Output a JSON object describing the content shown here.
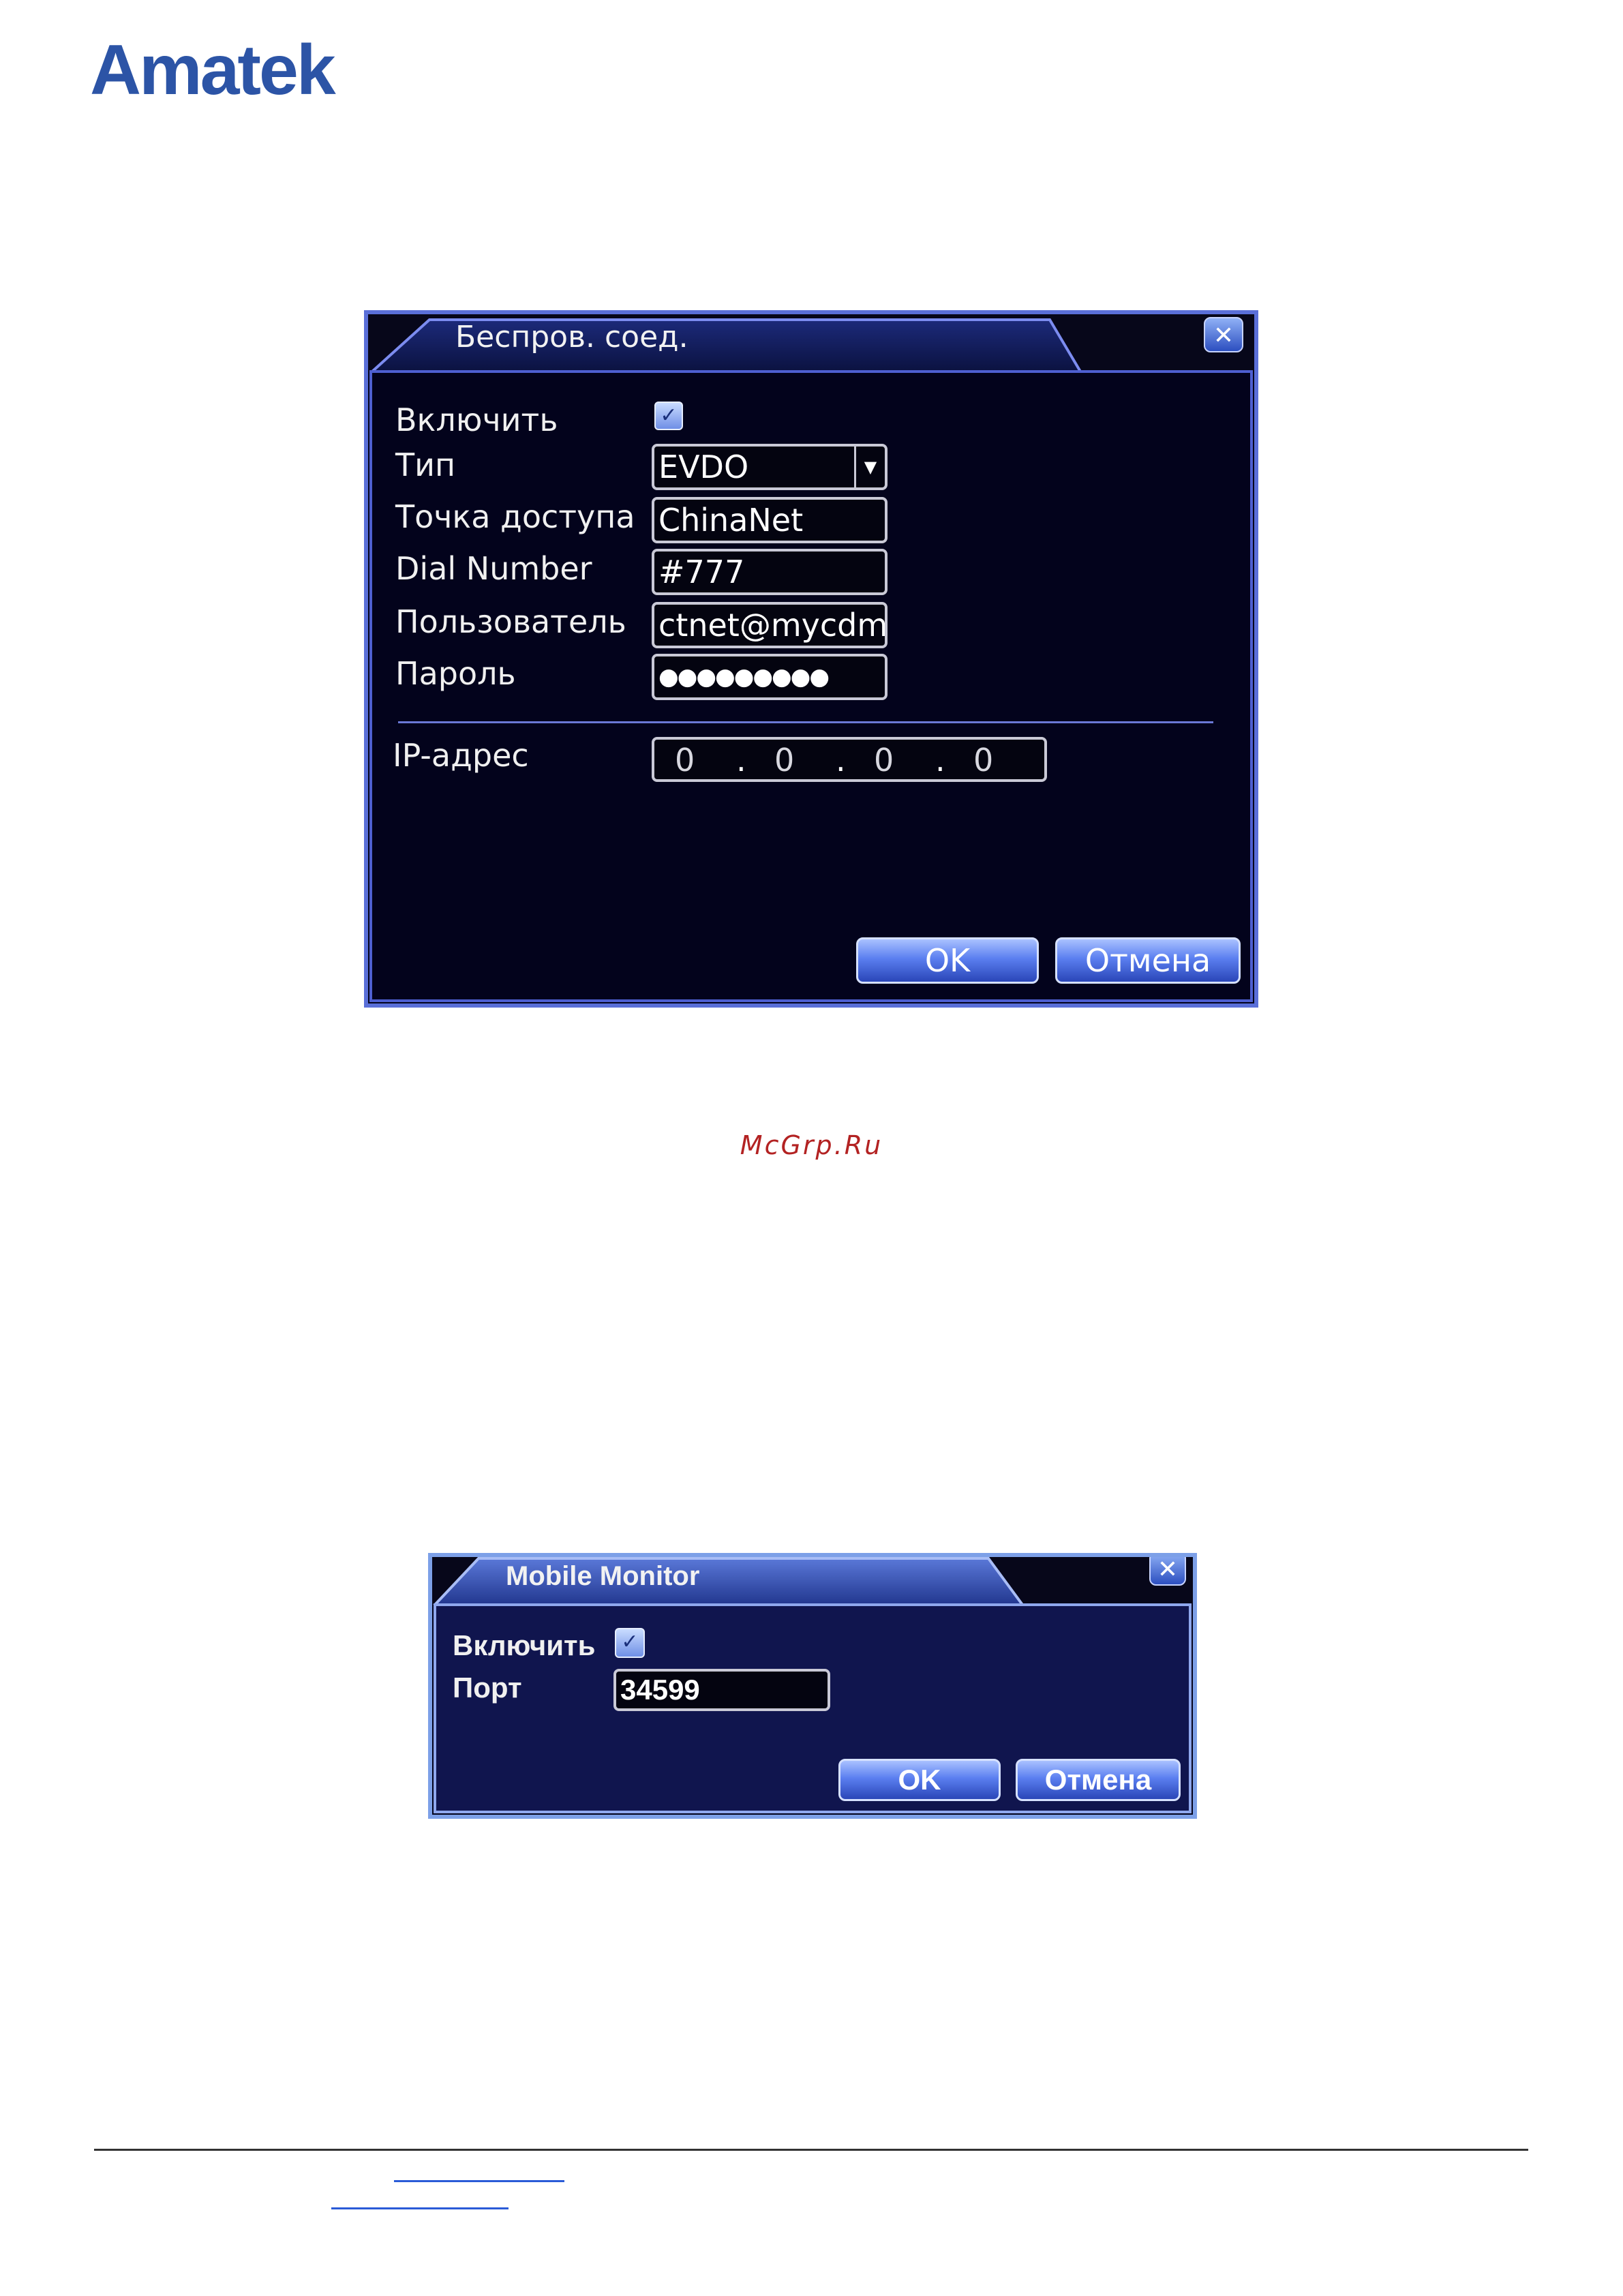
{
  "brand": {
    "logo_text": "Amatek"
  },
  "wireless_dialog": {
    "title": "Беспров. соед.",
    "enable_label": "Включить",
    "enable_checked": true,
    "type_label": "Тип",
    "type_value": "EVDO",
    "apn_label": "Точка доступа",
    "apn_value": "ChinaNet",
    "dial_label": "Dial Number",
    "dial_value": "#777",
    "user_label": "Пользователь",
    "user_value": "ctnet@mycdm",
    "password_label": "Пароль",
    "password_value": "●●●●●●●●●",
    "ip_label": "IP-адрес",
    "ip_octets": [
      "0",
      "0",
      "0",
      "0"
    ],
    "ip_separator": ".",
    "ok_label": "OK",
    "cancel_label": "Отмена",
    "close_icon": "close-icon"
  },
  "caption": "McGrp.Ru",
  "mobile_dialog": {
    "title": "Mobile Monitor",
    "enable_label": "Включить",
    "enable_checked": true,
    "port_label": "Порт",
    "port_value": "34599",
    "ok_label": "OK",
    "cancel_label": "Отмена",
    "close_icon": "close-icon"
  },
  "colors": {
    "brand": "#2c54a6",
    "dialog_bg": "#03031c",
    "dialog_border": "#5a6fd8",
    "caption": "#b32222"
  }
}
